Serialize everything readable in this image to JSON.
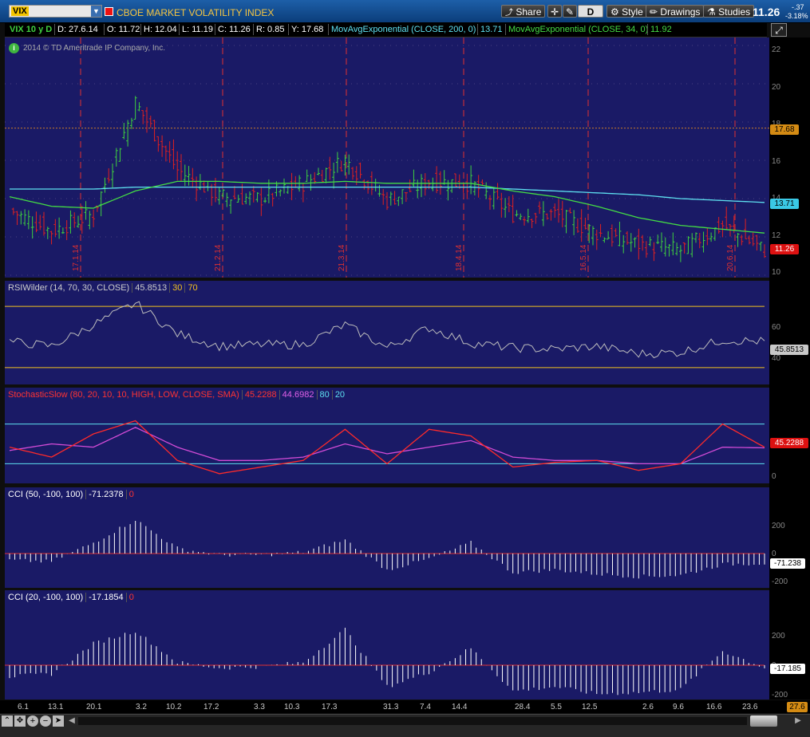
{
  "toolbar": {
    "symbol": "VIX",
    "title": "CBOE MARKET VOLATILITY INDEX",
    "share": "Share",
    "aggregation": "D",
    "style": "Style",
    "drawings": "Drawings",
    "studies": "Studies",
    "last": "11.26",
    "change": "-.37",
    "change_pct": "-3.18%"
  },
  "infobar": {
    "period": "VIX 10 y D",
    "date": "D: 27.6.14",
    "open": "O: 11.72",
    "high": "H: 12.04",
    "low": "L: 11.19",
    "close": "C: 11.26",
    "range": "R: 0.85",
    "year": "Y: 17.68",
    "study1": "MovAvgExponential (CLOSE, 200, 0)",
    "study1_val": "13.71",
    "study2": "MovAvgExponential (CLOSE, 34, 0)",
    "study2_val": "11.92",
    "copyright": "2014 © TD Ameritrade IP Company, Inc."
  },
  "price_axis": [
    "22",
    "20",
    "18",
    "16",
    "14",
    "12",
    "10"
  ],
  "price_tags": {
    "year_high": "17.68",
    "ema200": "13.71",
    "last": "11.26"
  },
  "vlines": [
    "17.1.14",
    "21.2.14",
    "21.3.14",
    "18.4.14",
    "16.5.14",
    "20.6.14"
  ],
  "rsi": {
    "label": "RSIWilder (14, 70, 30, CLOSE)",
    "value": "45.8513",
    "ob": "30",
    "os": "70",
    "axis": [
      "60",
      "40"
    ],
    "tag": "45.8513"
  },
  "stoch": {
    "label": "StochasticSlow (80, 20, 10, 10, HIGH, LOW, CLOSE, SMA)",
    "k": "45.2288",
    "d": "44.6982",
    "ob": "80",
    "os": "20",
    "axis": [
      "0"
    ],
    "tag": "45.2288"
  },
  "cci50": {
    "label": "CCI (50, -100, 100)",
    "value": "-71.2378",
    "zero": "0",
    "axis": [
      "200",
      "0",
      "-200"
    ],
    "tag": "-71.238"
  },
  "cci20": {
    "label": "CCI (20, -100, 100)",
    "value": "-17.1854",
    "zero": "0",
    "axis": [
      "200",
      "0",
      "-200"
    ],
    "tag": "-17.185"
  },
  "xaxis": [
    "6.1",
    "13.1",
    "20.1",
    "3.2",
    "10.2",
    "17.2",
    "3.3",
    "10.3",
    "17.3",
    "31.3",
    "7.4",
    "14.4",
    "28.4",
    "5.5",
    "12.5",
    "2.6",
    "9.6",
    "16.6",
    "23.6"
  ],
  "xaxis_tag": "27.6",
  "colors": {
    "panel": "#1a1a66",
    "up": "#3fd13f",
    "down": "#e02020",
    "ema200": "#5ee0f0",
    "ema34": "#44dd44",
    "grid": "#c87a2a",
    "rsi": "#bdbdbd",
    "stoch_k": "#ff2a2a",
    "stoch_d": "#d24bd6"
  },
  "chart_data": [
    {
      "type": "line",
      "title": "CBOE MARKET VOLATILITY INDEX",
      "x": [
        "6.1",
        "13.1",
        "20.1",
        "3.2",
        "10.2",
        "17.2",
        "3.3",
        "10.3",
        "17.3",
        "31.3",
        "7.4",
        "14.4",
        "28.4",
        "5.5",
        "12.5",
        "2.6",
        "9.6",
        "16.6",
        "23.6"
      ],
      "series": [
        {
          "name": "VIX close",
          "values": [
            13.4,
            12.3,
            13.2,
            19.0,
            15.5,
            14.1,
            14.0,
            14.8,
            16.0,
            13.9,
            14.9,
            14.8,
            13.2,
            13.2,
            12.2,
            11.6,
            11.3,
            12.6,
            11.3
          ]
        },
        {
          "name": "MovAvgExponential (CLOSE, 200, 0)",
          "values": [
            14.5,
            14.5,
            14.5,
            14.6,
            14.6,
            14.6,
            14.6,
            14.6,
            14.6,
            14.6,
            14.6,
            14.6,
            14.5,
            14.4,
            14.3,
            14.2,
            14.0,
            13.9,
            13.8
          ]
        },
        {
          "name": "MovAvgExponential (CLOSE, 34, 0)",
          "values": [
            14.1,
            13.6,
            13.5,
            14.4,
            14.9,
            14.9,
            14.8,
            14.8,
            14.9,
            14.8,
            14.8,
            14.8,
            14.4,
            14.1,
            13.6,
            13.0,
            12.6,
            12.4,
            12.2
          ]
        }
      ],
      "ylim": [
        10,
        22
      ]
    },
    {
      "type": "line",
      "title": "RSIWilder (14, 70, 30, CLOSE)",
      "series": [
        {
          "name": "RSI",
          "values": [
            47,
            44,
            58,
            72,
            52,
            44,
            45,
            45,
            58,
            43,
            56,
            46,
            43,
            42,
            44,
            39,
            40,
            48,
            47
          ]
        }
      ],
      "ylim": [
        30,
        70
      ]
    },
    {
      "type": "line",
      "title": "StochasticSlow (80, 20, 10, 10, HIGH, LOW, CLOSE, SMA)",
      "series": [
        {
          "name": "K",
          "values": [
            45,
            30,
            65,
            85,
            25,
            5,
            15,
            25,
            72,
            20,
            72,
            62,
            15,
            22,
            25,
            10,
            20,
            80,
            45
          ]
        },
        {
          "name": "D",
          "values": [
            40,
            50,
            45,
            75,
            45,
            25,
            25,
            30,
            50,
            35,
            45,
            55,
            30,
            25,
            25,
            20,
            20,
            45,
            44
          ]
        }
      ],
      "ylim": [
        0,
        100
      ]
    },
    {
      "type": "bar",
      "title": "CCI (50, -100, 100)",
      "values": [
        -50,
        -60,
        80,
        250,
        40,
        -10,
        -10,
        10,
        100,
        -120,
        -40,
        80,
        -140,
        -120,
        -150,
        -170,
        -160,
        -80,
        -71
      ]
    },
    {
      "type": "bar",
      "title": "CCI (20, -100, 100)",
      "values": [
        -80,
        -60,
        150,
        240,
        20,
        -20,
        -10,
        20,
        250,
        -150,
        -50,
        120,
        -180,
        -150,
        -200,
        -190,
        -170,
        100,
        -17
      ]
    }
  ]
}
